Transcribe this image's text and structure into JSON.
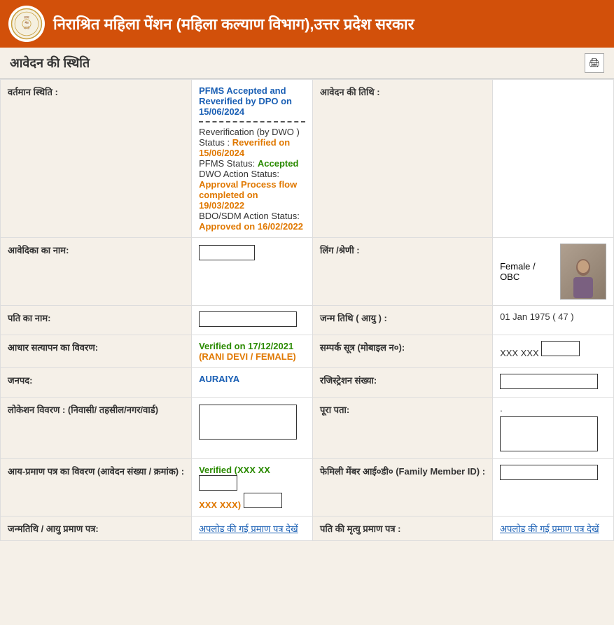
{
  "header": {
    "title": "निराश्रित महिला पेंशन (महिला कल्याण विभाग),उत्तर प्रदेश सरकार",
    "logo_alt": "UP Govt Logo"
  },
  "sub_header": {
    "title": "आवेदन की स्थिति",
    "icon": "📋"
  },
  "status_section": {
    "current_status_label": "वर्तमान स्थिति :",
    "current_status_value_line1": "PFMS Accepted and Reverified by DPO on 15/06/2024",
    "reverification_label": "Reverification (by DWO )",
    "reverification_status_label": "Status :",
    "reverification_status_value": "Reverified on 15/06/2024",
    "pfms_status_label": "PFMS Status:",
    "pfms_status_value": "Accepted",
    "dwo_action_label": "DWO Action Status:",
    "dwo_action_value": "Approval Process flow completed on 19/03/2022",
    "bdo_action_label": "BDO/SDM Action Status:",
    "bdo_action_value": "Approved on 16/02/2022",
    "application_date_label": "आवेदन की तिथि :"
  },
  "applicant": {
    "name_label": "आवेदिका का नाम:",
    "name_value": "",
    "gender_label": "लिंग /श्रेणी :",
    "gender_value": "Female / OBC",
    "husband_label": "पति का नाम:",
    "husband_value": "",
    "dob_label": "जन्म तिथि ( आयु ) :",
    "dob_value": "01 Jan 1975   ( 47 )",
    "aadhar_label": "आधार सत्यापन का विवरण:",
    "aadhar_value": "Verified on 17/12/2021",
    "aadhar_name": "(RANI DEVI / FEMALE)",
    "mobile_label": "सम्पर्क सूत्र (मोबाइल न०):",
    "mobile_prefix": "XXX XXX",
    "district_label": "जनपद:",
    "district_value": "AURAIYA",
    "registration_label": "रजिस्ट्रेशन संख्या:",
    "location_label": "लोकेशन विवरण : (निवासी/ तहसील/नगर/वार्ड)",
    "full_address_label": "पूरा पता:",
    "full_address_value": ".",
    "income_label": "आय-प्रमाण पत्र का विवरण (आवेदन संख्या / क्रमांक) :",
    "income_prefix": "Verified (XXX XX",
    "income_suffix": "XXX XXX)",
    "family_id_label": "फेमिली मेंबर आई०डी० (Family Member ID) :",
    "dob_proof_label": "जन्मतिथि / आयु प्रमाण पत्र:",
    "dob_proof_link": "अपलोड की गई प्रमाण पत्र देखें",
    "husband_death_label": "पति की मृत्यु प्रमाण पत्र :",
    "husband_death_link": "अपलोड की गई प्रमाण पत्र देखें"
  }
}
